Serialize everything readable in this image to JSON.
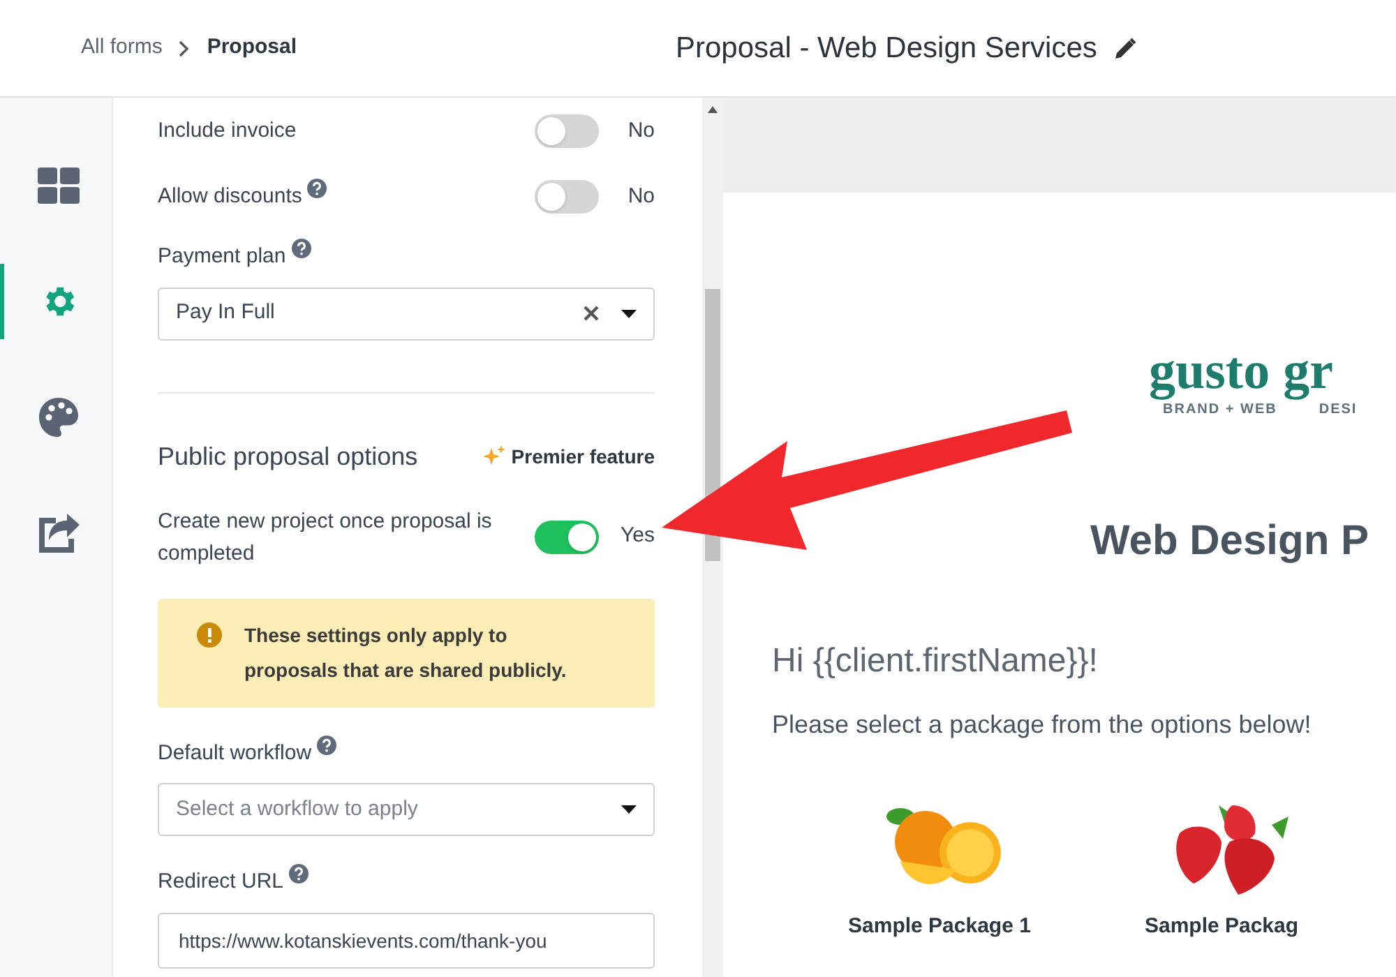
{
  "breadcrumb": [
    {
      "label": "All forms",
      "current": false
    },
    {
      "label": "Proposal",
      "current": true
    }
  ],
  "title": "Proposal - Web Design Services",
  "rail": [
    {
      "kind": "grid",
      "selected": false
    },
    {
      "kind": "gear",
      "selected": true
    },
    {
      "kind": "palette",
      "selected": false
    },
    {
      "kind": "share",
      "selected": false
    }
  ],
  "settings": {
    "toggles": [
      {
        "label": "Include invoice",
        "help": false,
        "on": false,
        "state_text": "No"
      },
      {
        "label": "Allow discounts",
        "help": true,
        "on": false,
        "state_text": "No"
      }
    ],
    "payment_plan": {
      "label": "Payment plan",
      "value": "Pay In Full"
    },
    "section": {
      "title": "Public proposal options",
      "badge": "Premier feature"
    },
    "project_toggle": {
      "label": "Create new project once proposal is completed",
      "on": true,
      "state_text": "Yes"
    },
    "notice": "These settings only apply to proposals that are shared publicly.",
    "workflow": {
      "label": "Default workflow",
      "placeholder": "Select a workflow to apply"
    },
    "redirect": {
      "label": "Redirect URL",
      "value": "https://www.kotanskievents.com/thank-you"
    }
  },
  "preview": {
    "logo": {
      "name": "gusto gr",
      "tagline_1": "BRAND + WEB",
      "tagline_2": "DESI"
    },
    "heading": "Web Design P",
    "greeting": "Hi {{client.firstName}}!",
    "intro": "Please select a package from the options below!",
    "packages": [
      {
        "kind": "orange",
        "name": "Sample Package 1"
      },
      {
        "kind": "strawberry",
        "name": "Sample Packag"
      }
    ]
  }
}
